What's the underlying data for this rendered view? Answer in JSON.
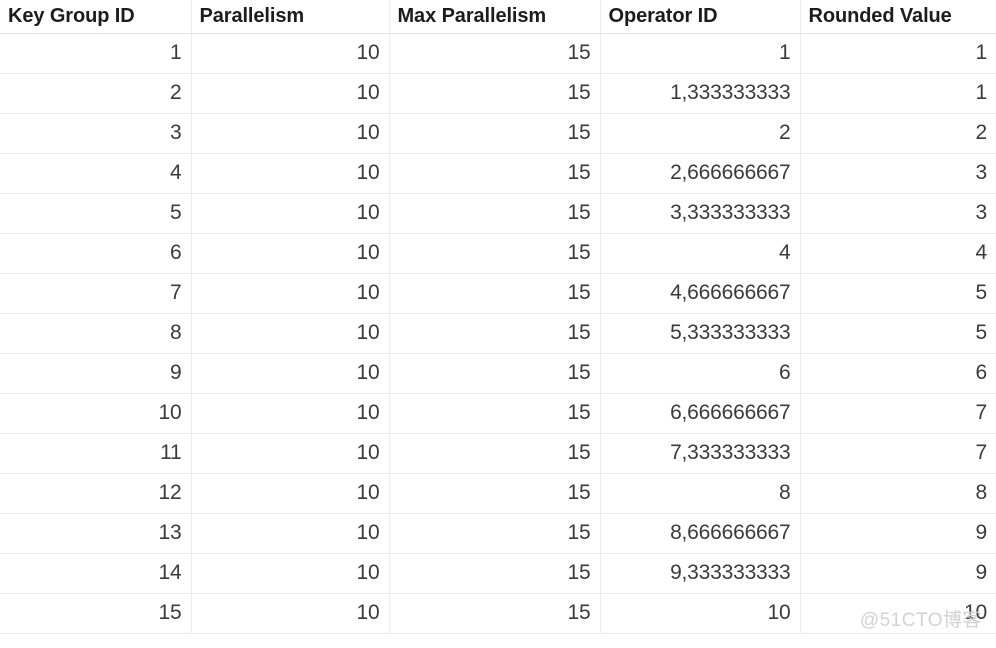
{
  "table": {
    "columns": [
      {
        "label": "Key Group ID",
        "align": "right"
      },
      {
        "label": "Parallelism",
        "align": "right"
      },
      {
        "label": "Max Parallelism",
        "align": "right"
      },
      {
        "label": "Operator ID",
        "align": "right"
      },
      {
        "label": "Rounded Value",
        "align": "right"
      }
    ],
    "rows": [
      [
        "1",
        "10",
        "15",
        "1",
        "1"
      ],
      [
        "2",
        "10",
        "15",
        "1,333333333",
        "1"
      ],
      [
        "3",
        "10",
        "15",
        "2",
        "2"
      ],
      [
        "4",
        "10",
        "15",
        "2,666666667",
        "3"
      ],
      [
        "5",
        "10",
        "15",
        "3,333333333",
        "3"
      ],
      [
        "6",
        "10",
        "15",
        "4",
        "4"
      ],
      [
        "7",
        "10",
        "15",
        "4,666666667",
        "5"
      ],
      [
        "8",
        "10",
        "15",
        "5,333333333",
        "5"
      ],
      [
        "9",
        "10",
        "15",
        "6",
        "6"
      ],
      [
        "10",
        "10",
        "15",
        "6,666666667",
        "7"
      ],
      [
        "11",
        "10",
        "15",
        "7,333333333",
        "7"
      ],
      [
        "12",
        "10",
        "15",
        "8",
        "8"
      ],
      [
        "13",
        "10",
        "15",
        "8,666666667",
        "9"
      ],
      [
        "14",
        "10",
        "15",
        "9,333333333",
        "9"
      ],
      [
        "15",
        "10",
        "15",
        "10",
        "10"
      ]
    ]
  },
  "watermark": {
    "text": "@51CTO博客"
  },
  "colors": {
    "header_text": "#1c1c1c",
    "cell_text": "#3b3b3b",
    "grid_line": "#ebebeb",
    "column_line": "#eceded",
    "background": "#ffffff",
    "watermark_text": "#d2d2d2"
  }
}
